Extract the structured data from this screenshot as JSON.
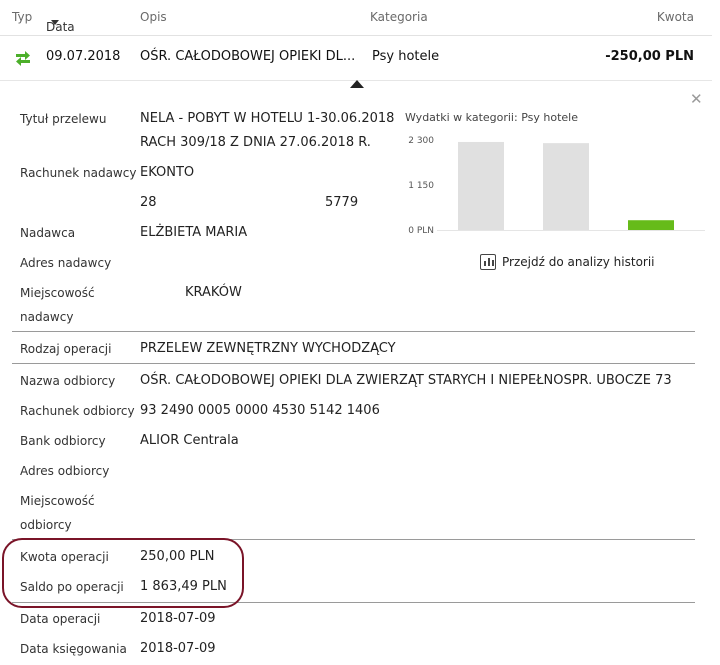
{
  "header": {
    "typ": "Typ",
    "data": "Data",
    "opis": "Opis",
    "kategoria": "Kategoria",
    "kwota": "Kwota"
  },
  "transaction": {
    "date": "09.07.2018",
    "description": "OŚR. CAŁODOBOWEJ OPIEKI DL...",
    "category": "Psy hotele",
    "amount": "-250,00 PLN",
    "icon": "transfer-arrows-icon"
  },
  "details": {
    "tytul_label": "Tytuł przelewu",
    "tytul_line1": "NELA - POBYT W HOTELU 1-30.06.2018",
    "tytul_line2": "RACH 309/18 Z DNIA 27.06.2018 R.",
    "rach_nad_label": "Rachunek nadawcy",
    "rach_nad_name": "EKONTO",
    "rach_nad_num_a": "28",
    "rach_nad_num_b": "5779",
    "nadawca_label": "Nadawca",
    "nadawca_value": "ELŻBIETA MARIA",
    "adres_nad_label": "Adres nadawcy",
    "miejsc_nad_label1": "Miejscowość",
    "miejsc_nad_label2": "nadawcy",
    "miejsc_nad_value": "KRAKÓW",
    "rodzaj_label": "Rodzaj operacji",
    "rodzaj_value": "PRZELEW ZEWNĘTRZNY WYCHODZĄCY",
    "nazwa_odb_label": "Nazwa odbiorcy",
    "nazwa_odb_value": "OŚR. CAŁODOBOWEJ OPIEKI DLA ZWIERZĄT STARYCH I NIEPEŁNOSPR. UBOCZE 73",
    "rach_odb_label": "Rachunek odbiorcy",
    "rach_odb_value": "93 2490 0005 0000 4530 5142 1406",
    "bank_odb_label": "Bank odbiorcy",
    "bank_odb_value": "ALIOR Centrala",
    "adres_odb_label": "Adres odbiorcy",
    "miejsc_odb_label1": "Miejscowość",
    "miejsc_odb_label2": "odbiorcy",
    "kwota_label": "Kwota operacji",
    "kwota_value": "250,00 PLN",
    "saldo_label": "Saldo po operacji",
    "saldo_value": "1 863,49 PLN",
    "data_op_label": "Data operacji",
    "data_op_value": "2018-07-09",
    "data_ksieg_label": "Data księgowania",
    "data_ksieg_value": "2018-07-09"
  },
  "chart_title": "Wydatki w kategorii:  Psy hotele",
  "history_link": "Przejdź do analizy historii",
  "chart_data": {
    "type": "bar",
    "title": "Wydatki w kategorii:  Psy hotele",
    "yticks": [
      "2 300",
      "1 150",
      "0 PLN"
    ],
    "ylim": [
      0,
      2300
    ],
    "values": [
      2250,
      2220,
      250
    ],
    "colors": [
      "#e0e0e0",
      "#e0e0e0",
      "#66bb1a"
    ]
  }
}
